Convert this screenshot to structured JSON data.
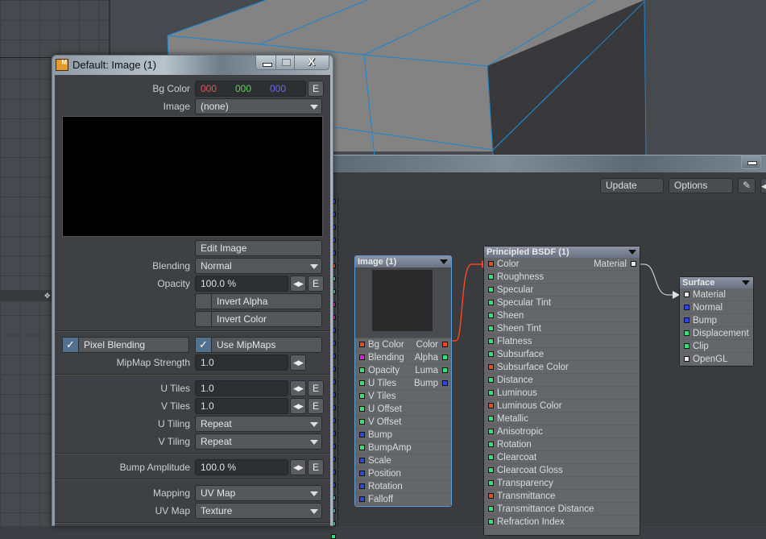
{
  "panel": {
    "title": "Default: Image (1)",
    "app_icon_letter": "M",
    "window_buttons": {
      "minimize": "minimize",
      "maximize": "maximize",
      "close": "X"
    },
    "bg_color": {
      "label": "Bg Color",
      "r": "000",
      "g": "000",
      "b": "000",
      "swatch": "#000000",
      "env_button": "E"
    },
    "image": {
      "label": "Image",
      "value": "(none)"
    },
    "edit_image_label": "Edit Image",
    "blending": {
      "label": "Blending",
      "value": "Normal"
    },
    "opacity": {
      "label": "Opacity",
      "value": "100.0 %",
      "env_button": "E"
    },
    "invert_alpha": {
      "label": "Invert Alpha",
      "checked": false
    },
    "invert_color": {
      "label": "Invert Color",
      "checked": false
    },
    "pixel_blending": {
      "label": "Pixel Blending",
      "checked": true
    },
    "use_mipmaps": {
      "label": "Use MipMaps",
      "checked": true
    },
    "mipmap_strength": {
      "label": "MipMap Strength",
      "value": "1.0"
    },
    "u_tiles": {
      "label": "U Tiles",
      "value": "1.0",
      "env_button": "E"
    },
    "v_tiles": {
      "label": "V Tiles",
      "value": "1.0",
      "env_button": "E"
    },
    "u_tiling": {
      "label": "U Tiling",
      "value": "Repeat"
    },
    "v_tiling": {
      "label": "V Tiling",
      "value": "Repeat"
    },
    "bump_amplitude": {
      "label": "Bump Amplitude",
      "value": "100.0 %",
      "env_button": "E"
    },
    "mapping": {
      "label": "Mapping",
      "value": "UV Map"
    },
    "uv_map": {
      "label": "UV Map",
      "value": "Texture"
    }
  },
  "node_editor": {
    "toolbar": {
      "update_label": "Update",
      "options_label": "Options"
    },
    "nodes": {
      "image": {
        "title": "Image (1)",
        "rows": [
          {
            "in": "Bg Color",
            "in_color": "red",
            "out": "Color",
            "out_color": "red"
          },
          {
            "in": "Blending",
            "in_color": "mag",
            "out": "Alpha",
            "out_color": "green"
          },
          {
            "in": "Opacity",
            "in_color": "green",
            "out": "Luma",
            "out_color": "green"
          },
          {
            "in": "U Tiles",
            "in_color": "green",
            "out": "Bump",
            "out_color": "blue"
          },
          {
            "in": "V Tiles",
            "in_color": "green"
          },
          {
            "in": "U Offset",
            "in_color": "green"
          },
          {
            "in": "V Offset",
            "in_color": "green"
          },
          {
            "in": "Bump",
            "in_color": "blue"
          },
          {
            "in": "BumpAmp",
            "in_color": "green"
          },
          {
            "in": "Scale",
            "in_color": "blue"
          },
          {
            "in": "Position",
            "in_color": "blue"
          },
          {
            "in": "Rotation",
            "in_color": "blue"
          },
          {
            "in": "Falloff",
            "in_color": "blue"
          }
        ]
      },
      "bsdf": {
        "title": "Principled BSDF (1)",
        "rows": [
          {
            "in": "Color",
            "in_color": "red",
            "out": "Material",
            "out_color": "white"
          },
          {
            "in": "Roughness",
            "in_color": "green"
          },
          {
            "in": "Specular",
            "in_color": "green"
          },
          {
            "in": "Specular Tint",
            "in_color": "green"
          },
          {
            "in": "Sheen",
            "in_color": "green"
          },
          {
            "in": "Sheen Tint",
            "in_color": "green"
          },
          {
            "in": "Flatness",
            "in_color": "green"
          },
          {
            "in": "Subsurface",
            "in_color": "green"
          },
          {
            "in": "Subsurface Color",
            "in_color": "red"
          },
          {
            "in": "Distance",
            "in_color": "green"
          },
          {
            "in": "Luminous",
            "in_color": "green"
          },
          {
            "in": "Luminous Color",
            "in_color": "red"
          },
          {
            "in": "Metallic",
            "in_color": "green"
          },
          {
            "in": "Anisotropic",
            "in_color": "green"
          },
          {
            "in": "Rotation",
            "in_color": "green"
          },
          {
            "in": "Clearcoat",
            "in_color": "green"
          },
          {
            "in": "Clearcoat Gloss",
            "in_color": "green"
          },
          {
            "in": "Transparency",
            "in_color": "green"
          },
          {
            "in": "Transmittance",
            "in_color": "red"
          },
          {
            "in": "Transmittance Distance",
            "in_color": "green"
          },
          {
            "in": "Refraction Index",
            "in_color": "green"
          }
        ]
      },
      "surface": {
        "title": "Surface",
        "rows": [
          {
            "in": "Material",
            "in_color": "white"
          },
          {
            "in": "Normal",
            "in_color": "blue"
          },
          {
            "in": "Bump",
            "in_color": "blue"
          },
          {
            "in": "Displacement",
            "in_color": "green"
          },
          {
            "in": "Clip",
            "in_color": "green"
          },
          {
            "in": "OpenGL",
            "in_color": "white"
          }
        ]
      }
    },
    "connections": [
      {
        "from": "Image (1).Color",
        "to": "Principled BSDF (1).Color",
        "color": "#f04a20"
      },
      {
        "from": "Principled BSDF (1).Material",
        "to": "Surface.Material",
        "color": "#e0e0e0"
      }
    ],
    "left_strip_ports": [
      "blue",
      "blue",
      "blue",
      "blue",
      "blue",
      "red",
      "green",
      "green",
      "mag",
      "mag",
      "blue",
      "blue",
      "blue",
      "blue",
      "blue",
      "blue",
      "blue",
      "blue",
      "blue",
      "blue",
      "blue",
      "blue",
      "blue",
      "cyan",
      "cyan",
      "green",
      "green"
    ]
  },
  "colors": {
    "wire_blue": "#1a86d0",
    "mesh_gray": "#838383",
    "mesh_dark": "#3b3b3d"
  }
}
